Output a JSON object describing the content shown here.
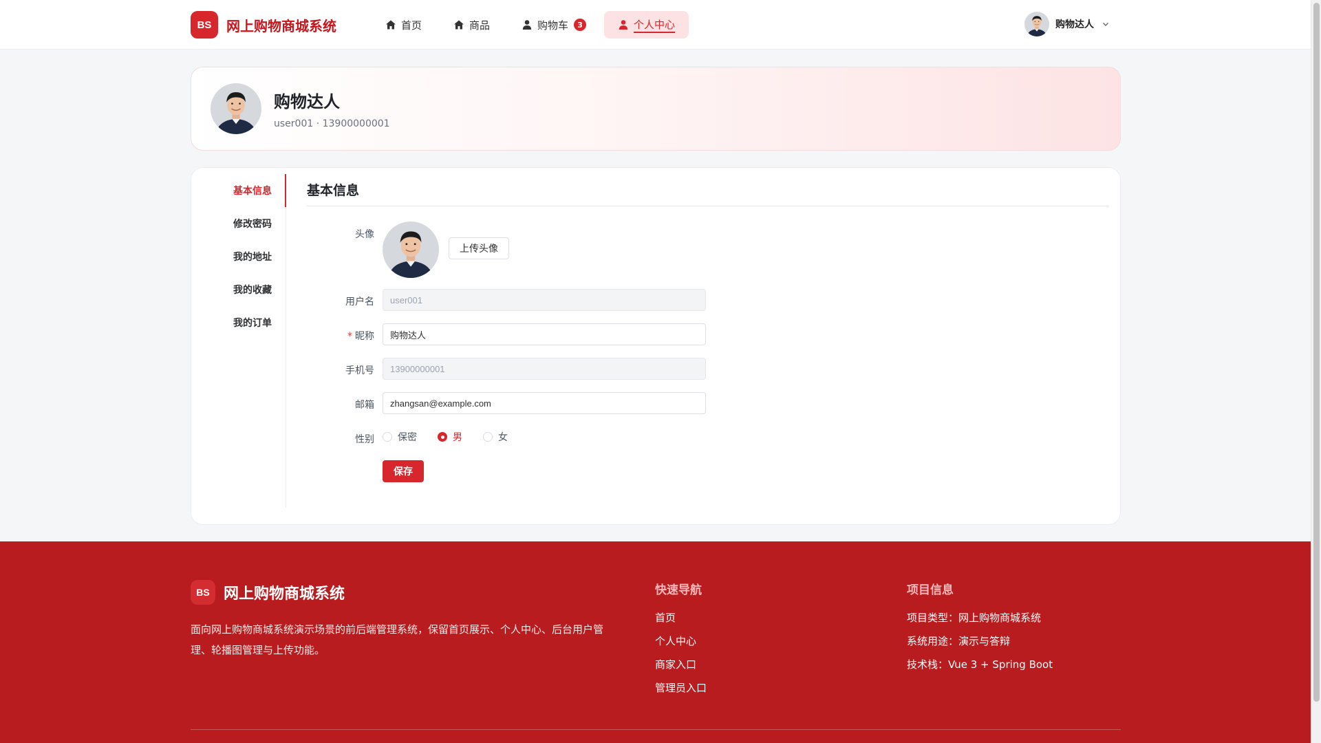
{
  "header": {
    "logo_text": "BS",
    "brand_title": "网上购物商城系统",
    "nav": [
      {
        "label": "首页"
      },
      {
        "label": "商品"
      },
      {
        "label": "购物车",
        "badge": "3"
      },
      {
        "label": "个人中心"
      }
    ],
    "user_name": "购物达人"
  },
  "profile": {
    "name": "购物达人",
    "sub": "user001 · 13900000001"
  },
  "sidebar": {
    "items": [
      {
        "label": "基本信息"
      },
      {
        "label": "修改密码"
      },
      {
        "label": "我的地址"
      },
      {
        "label": "我的收藏"
      },
      {
        "label": "我的订单"
      }
    ]
  },
  "form": {
    "title": "基本信息",
    "avatar_label": "头像",
    "upload_label": "上传头像",
    "username_label": "用户名",
    "username_value": "user001",
    "nickname_label": "昵称",
    "nickname_required": "*",
    "nickname_value": "购物达人",
    "phone_label": "手机号",
    "phone_value": "13900000001",
    "email_label": "邮箱",
    "email_value": "zhangsan@example.com",
    "gender_label": "性别",
    "gender_options": [
      "保密",
      "男",
      "女"
    ],
    "gender_selected": "男",
    "save_label": "保存"
  },
  "footer": {
    "logo_text": "BS",
    "title": "网上购物商城系统",
    "desc": "面向网上购物商城系统演示场景的前后端管理系统，保留首页展示、个人中心、后台用户管理、轮播图管理与上传功能。",
    "quick_nav_title": "快速导航",
    "quick_nav": [
      "首页",
      "个人中心",
      "商家入口",
      "管理员入口"
    ],
    "project_title": "项目信息",
    "project_info": [
      "项目类型：网上购物商城系统",
      "系统用途：演示与答辩",
      "技术栈：Vue 3 + Spring Boot"
    ]
  },
  "colors": {
    "accent": "#d7262c",
    "footer_bg": "#b91c1f"
  }
}
